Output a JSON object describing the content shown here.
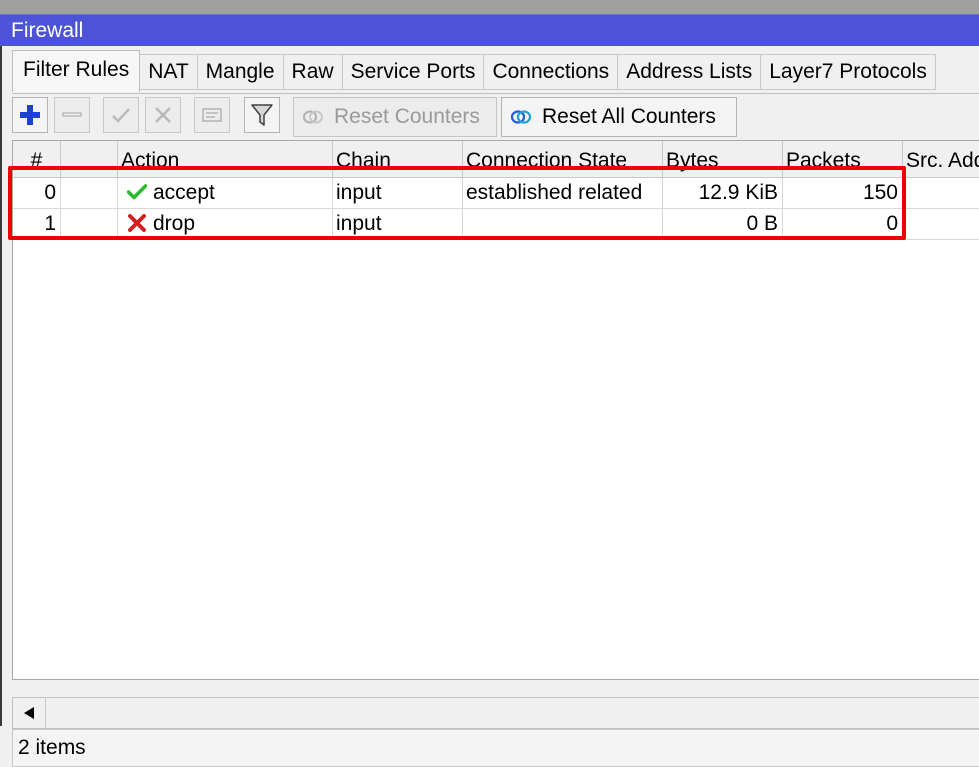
{
  "window": {
    "title": "Firewall"
  },
  "tabs": [
    {
      "label": "Filter Rules",
      "active": true
    },
    {
      "label": "NAT"
    },
    {
      "label": "Mangle"
    },
    {
      "label": "Raw"
    },
    {
      "label": "Service Ports"
    },
    {
      "label": "Connections"
    },
    {
      "label": "Address Lists"
    },
    {
      "label": "Layer7 Protocols"
    }
  ],
  "toolbar": {
    "icons": [
      "add-icon",
      "remove-icon",
      "enable-icon",
      "disable-icon",
      "comment-icon",
      "filter-icon"
    ],
    "reset_counters": "Reset Counters",
    "reset_all_counters": "Reset All Counters"
  },
  "table": {
    "columns": [
      "#",
      "",
      "Action",
      "Chain",
      "Connection State",
      "Bytes",
      "Packets",
      "Src. Add"
    ],
    "rows": [
      {
        "num": "0",
        "action": "accept",
        "action_icon": "checkmark-icon",
        "chain": "input",
        "connection_state": "established related",
        "bytes": "12.9 KiB",
        "packets": "150"
      },
      {
        "num": "1",
        "action": "drop",
        "action_icon": "cross-icon",
        "chain": "input",
        "connection_state": "",
        "bytes": "0 B",
        "packets": "0"
      }
    ]
  },
  "status": {
    "items": "2 items"
  },
  "colors": {
    "titlebar": "#4d53d6",
    "highlight": "#ee0000",
    "accept": "#2db82d",
    "drop": "#d02020",
    "add": "#1f3fd0"
  }
}
